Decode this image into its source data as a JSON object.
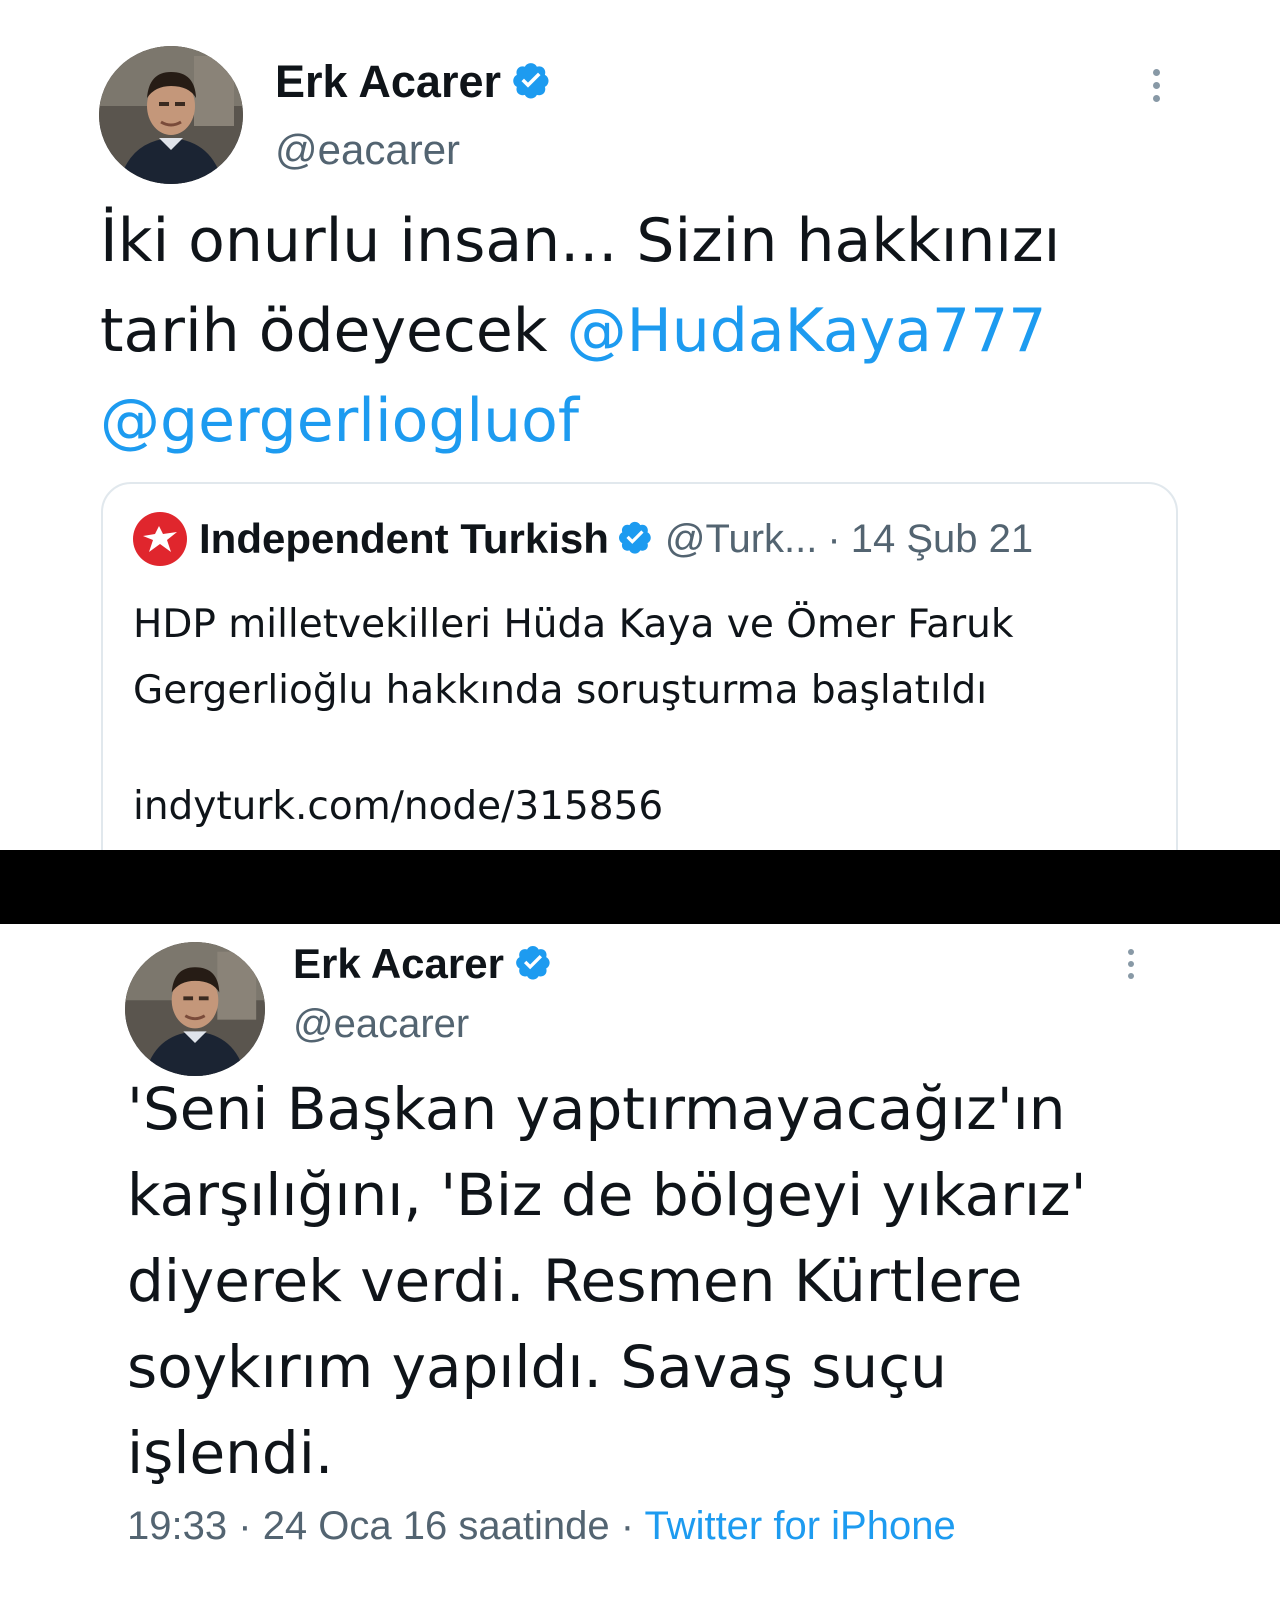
{
  "tweet1": {
    "display_name": "Erk Acarer",
    "handle": "@eacarer",
    "text_line1": "İki onurlu insan... Sizin hakkınızı",
    "text_line2_plain": "tarih ödeyecek ",
    "mention1": "@HudaKaya777",
    "mention2": "@gergerliogluof",
    "quote": {
      "name": "Independent Turkish",
      "handle": "@Turk...",
      "separator": "·",
      "date": "14 Şub 21",
      "text_line1": "HDP milletvekilleri Hüda Kaya ve Ömer Faruk",
      "text_line2": "Gergerlioğlu hakkında soruşturma başlatıldı",
      "link": "indyturk.com/node/315856"
    }
  },
  "tweet2": {
    "display_name": "Erk Acarer",
    "handle": "@eacarer",
    "text_lines": [
      "'Seni Başkan yaptırmayacağız'ın",
      "karşılığını, 'Biz de bölgeyi yıkarız'",
      "diyerek verdi. Resmen Kürtlere",
      "soykırım yapıldı. Savaş suçu",
      "işlendi."
    ],
    "time": "19:33",
    "separator": "·",
    "date": "24 Oca 16 saatinde",
    "source": "Twitter for iPhone"
  },
  "colors": {
    "accent": "#1d9bf0",
    "secondary_text": "#536471",
    "separator_bar": "#000000",
    "independent_red": "#e0262d"
  },
  "icons": {
    "verified": "verified-badge-icon",
    "more": "more-vertical-icon",
    "quote_logo": "independent-eagle-logo-icon"
  }
}
